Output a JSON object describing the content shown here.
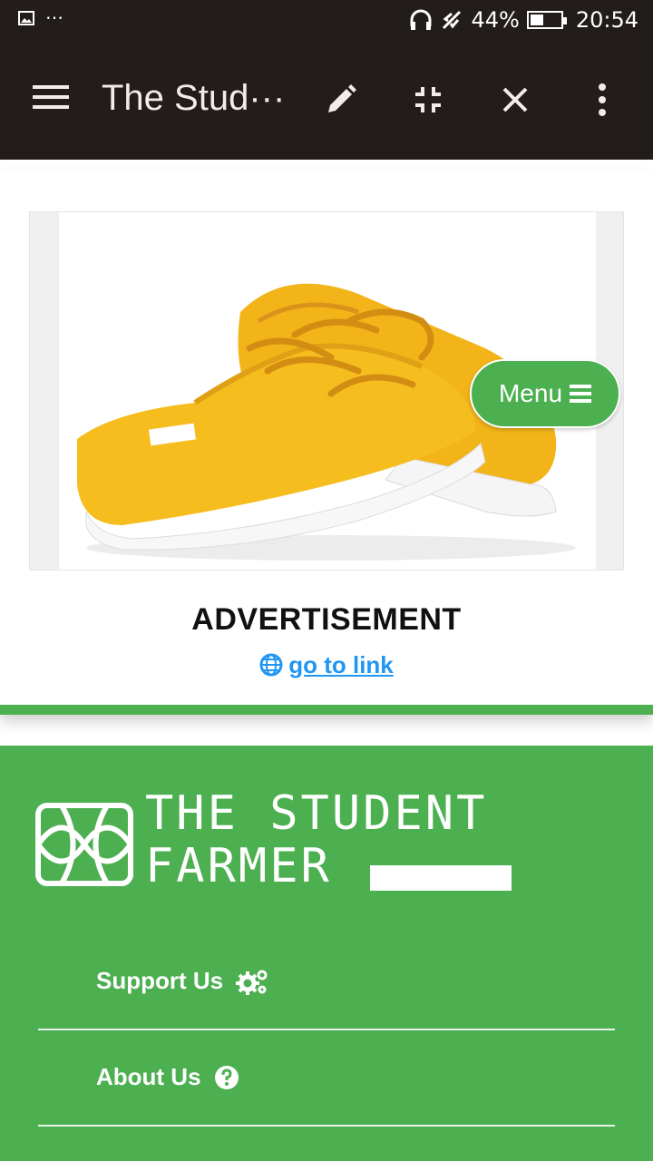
{
  "status_bar": {
    "battery_percent": "44%",
    "battery_level": 0.44,
    "time": "20:54",
    "icons": [
      "image-icon",
      "more-dots-icon",
      "headphones-icon",
      "airplane-mode-icon",
      "battery-icon"
    ]
  },
  "toolbar": {
    "title": "The Stud···",
    "icons": [
      "menu-icon",
      "edit-icon",
      "exit-fullscreen-icon",
      "close-icon",
      "more-vert-icon"
    ]
  },
  "ad": {
    "heading": "ADVERTISEMENT",
    "link_text": "go to link",
    "image_subject": "yellow-sneakers"
  },
  "floating_menu": {
    "label": "Menu"
  },
  "footer": {
    "logo_line1": "THE STUDENT",
    "logo_line2": "FARMER",
    "items": [
      {
        "label": "Support Us",
        "icon": "cogs-icon"
      },
      {
        "label": "About Us",
        "icon": "question-circle-icon"
      }
    ]
  },
  "colors": {
    "accent_green": "#4caf50",
    "toolbar_bg": "#221c1a",
    "link_blue": "#2196f3"
  }
}
